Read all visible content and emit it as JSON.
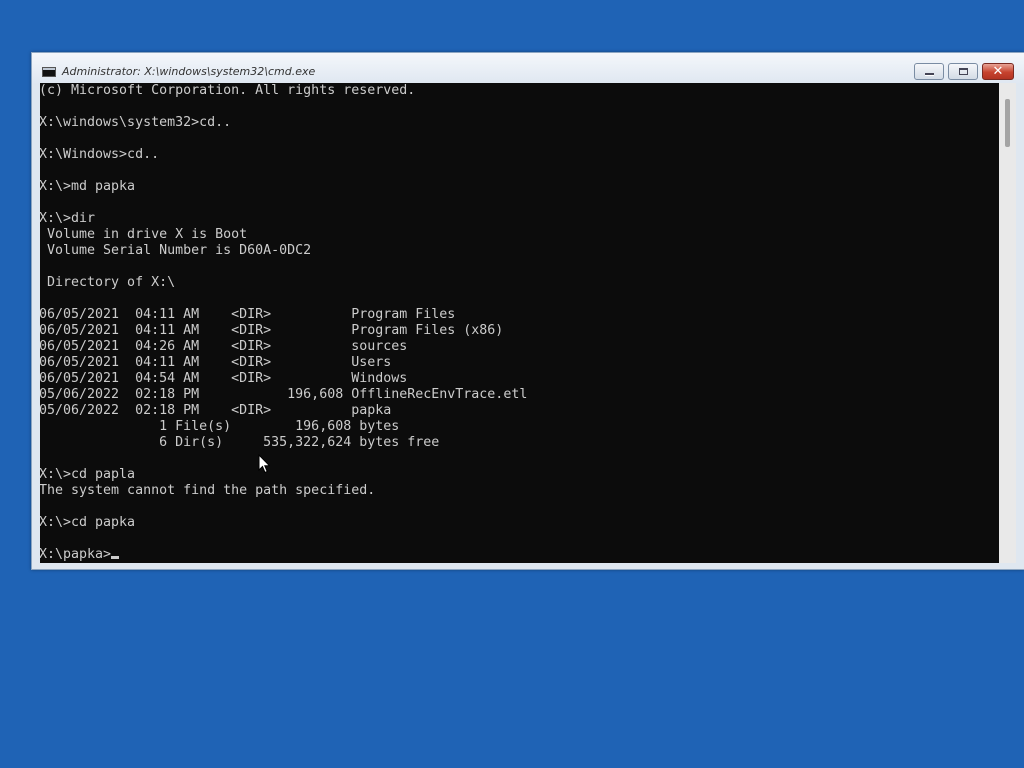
{
  "window": {
    "title": "Administrator: X:\\windows\\system32\\cmd.exe",
    "buttons": {
      "minimize_icon": "minimize-icon",
      "maximize_icon": "maximize-icon",
      "close_icon": "close-icon",
      "close_glyph": "✕"
    }
  },
  "console": {
    "lines": [
      "(c) Microsoft Corporation. All rights reserved.",
      "",
      "X:\\windows\\system32>cd..",
      "",
      "X:\\Windows>cd..",
      "",
      "X:\\>md papka",
      "",
      "X:\\>dir",
      " Volume in drive X is Boot",
      " Volume Serial Number is D60A-0DC2",
      "",
      " Directory of X:\\",
      "",
      "06/05/2021  04:11 AM    <DIR>          Program Files",
      "06/05/2021  04:11 AM    <DIR>          Program Files (x86)",
      "06/05/2021  04:26 AM    <DIR>          sources",
      "06/05/2021  04:11 AM    <DIR>          Users",
      "06/05/2021  04:54 AM    <DIR>          Windows",
      "05/06/2022  02:18 PM           196,608 OfflineRecEnvTrace.etl",
      "05/06/2022  02:18 PM    <DIR>          papka",
      "               1 File(s)        196,608 bytes",
      "               6 Dir(s)     535,322,624 bytes free",
      "",
      "X:\\>cd papla",
      "The system cannot find the path specified.",
      "",
      "X:\\>cd papka",
      ""
    ],
    "prompt": "X:\\papka>"
  },
  "colors": {
    "desktop": "#1f63b5",
    "console_bg": "#0c0c0c",
    "console_text": "#cccccc",
    "close_button": "#c7432f"
  },
  "icons": {
    "app": "cmd-icon",
    "mouse": "mouse-pointer-icon"
  }
}
